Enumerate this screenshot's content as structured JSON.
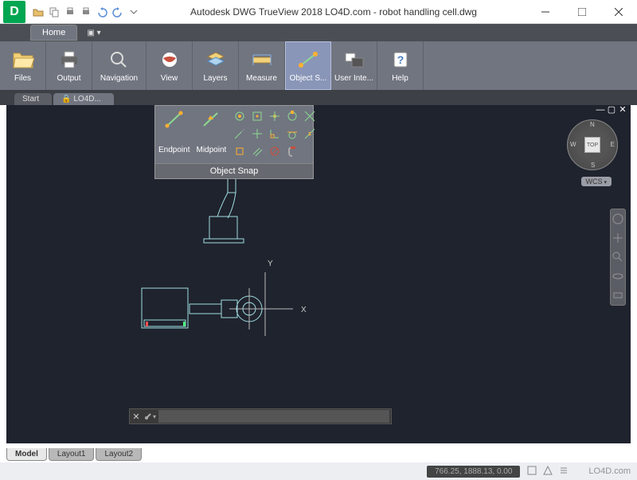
{
  "title": "Autodesk DWG TrueView 2018     LO4D.com - robot handling cell.dwg",
  "app_letter": "D",
  "home_label": "Home",
  "ribbon": [
    {
      "label": "Files",
      "name": "files-button"
    },
    {
      "label": "Output",
      "name": "output-button"
    },
    {
      "label": "Navigation",
      "name": "navigation-button"
    },
    {
      "label": "View",
      "name": "view-button"
    },
    {
      "label": "Layers",
      "name": "layers-button"
    },
    {
      "label": "Measure",
      "name": "measure-button"
    },
    {
      "label": "Object S...",
      "name": "object-snap-button"
    },
    {
      "label": "User Inte...",
      "name": "user-interface-button"
    },
    {
      "label": "Help",
      "name": "help-button"
    }
  ],
  "doc_tabs": [
    {
      "label": "Start",
      "active": false
    },
    {
      "label": "LO4D...",
      "active": true
    }
  ],
  "osnap": {
    "endpoint": "Endpoint",
    "midpoint": "Midpoint",
    "title": "Object Snap"
  },
  "viewcube": {
    "face": "TOP",
    "n": "N",
    "s": "S",
    "e": "E",
    "w": "W",
    "wcs": "WCS"
  },
  "axes": {
    "x": "X",
    "y": "Y"
  },
  "layout_tabs": [
    {
      "label": "Model",
      "active": true
    },
    {
      "label": "Layout1",
      "active": false
    },
    {
      "label": "Layout2",
      "active": false
    }
  ],
  "status": {
    "coords": "766.25, 1888.13, 0.00",
    "watermark": "LO4D.com"
  }
}
